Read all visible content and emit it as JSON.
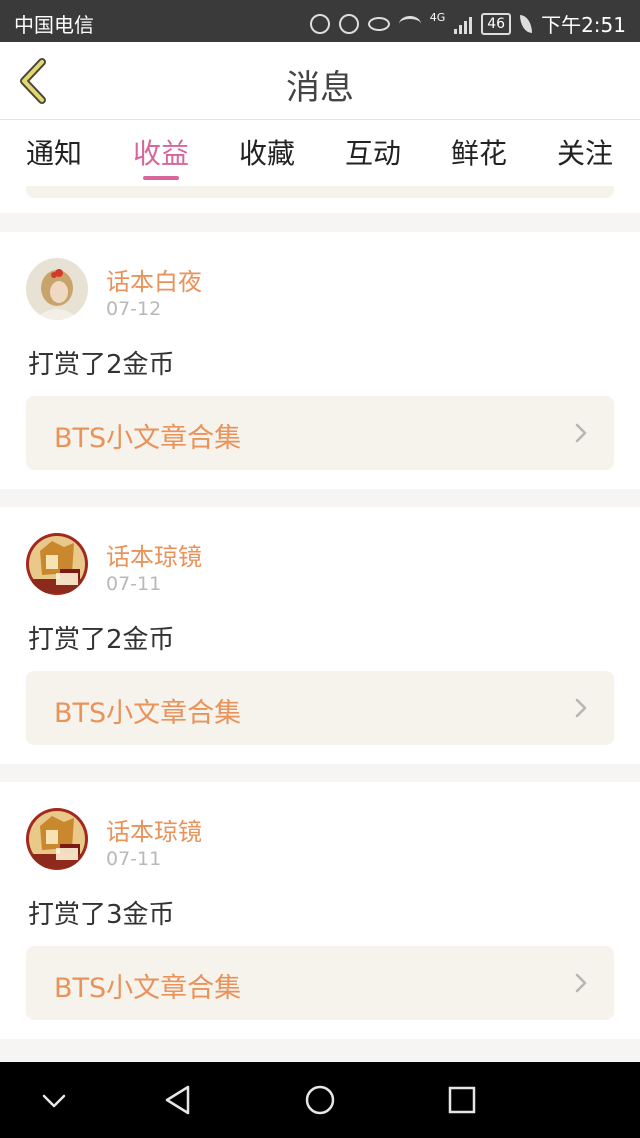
{
  "status_bar": {
    "carrier": "中国电信",
    "network": "4G",
    "battery": "46",
    "time": "下午2:51"
  },
  "header": {
    "title": "消息",
    "back_icon": "chevron-left-icon"
  },
  "tabs": [
    {
      "label": "通知",
      "active": false
    },
    {
      "label": "收益",
      "active": true
    },
    {
      "label": "收藏",
      "active": false
    },
    {
      "label": "互动",
      "active": false
    },
    {
      "label": "鲜花",
      "active": false
    },
    {
      "label": "关注",
      "active": false
    }
  ],
  "colors": {
    "accent": "#d9659d",
    "name": "#e9925a",
    "link_bg": "#f5f3ec"
  },
  "messages": [
    {
      "user": "话本白夜",
      "date": "07-12",
      "text": "打赏了2金币",
      "article": "BTS小文章合集",
      "avatar": "girl-photo-avatar"
    },
    {
      "user": "话本琼镜",
      "date": "07-11",
      "text": "打赏了2金币",
      "article": "BTS小文章合集",
      "avatar": "illustrated-avatar"
    },
    {
      "user": "话本琼镜",
      "date": "07-11",
      "text": "打赏了3金币",
      "article": "BTS小文章合集",
      "avatar": "illustrated-avatar"
    }
  ],
  "nav_bar": {
    "items": [
      "collapse-icon",
      "back-triangle-icon",
      "home-circle-icon",
      "recents-square-icon"
    ]
  }
}
